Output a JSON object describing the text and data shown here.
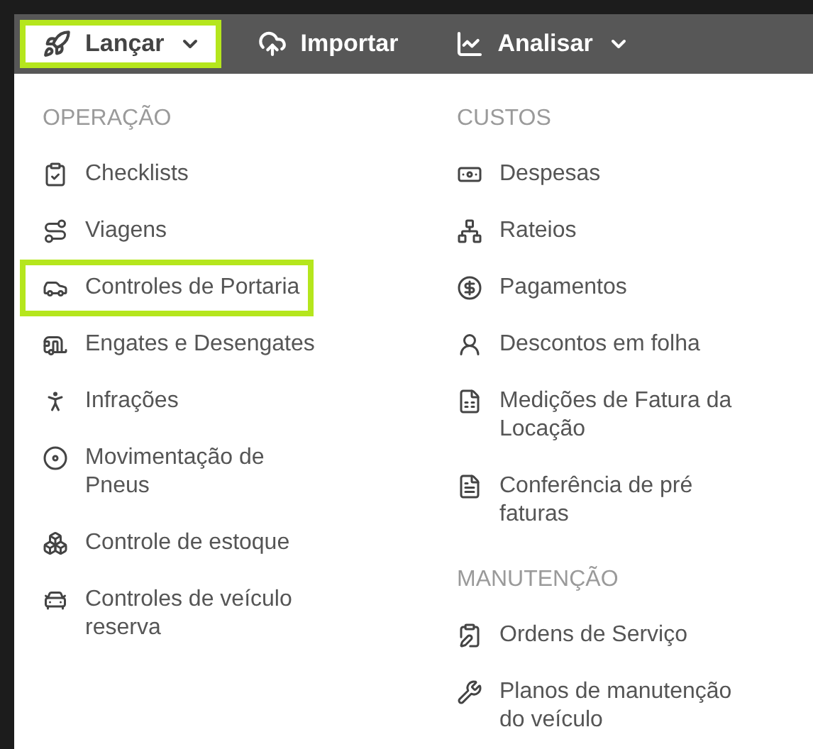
{
  "nav": [
    {
      "label": "Lançar",
      "caret": true,
      "highlighted": true
    },
    {
      "label": "Importar",
      "caret": false,
      "highlighted": false
    },
    {
      "label": "Analisar",
      "caret": true,
      "highlighted": false
    }
  ],
  "columns": [
    {
      "sections": [
        {
          "title": "OPERAÇÃO",
          "items": [
            {
              "label": "Checklists",
              "highlighted": false
            },
            {
              "label": "Viagens",
              "highlighted": false
            },
            {
              "label": "Controles de Portaria",
              "highlighted": true
            },
            {
              "label": "Engates e Desengates",
              "highlighted": false
            },
            {
              "label": "Infrações",
              "highlighted": false
            },
            {
              "label": "Movimentação de Pneus",
              "highlighted": false
            },
            {
              "label": "Controle de estoque",
              "highlighted": false
            },
            {
              "label": "Controles de veículo reserva",
              "highlighted": false
            }
          ]
        }
      ]
    },
    {
      "sections": [
        {
          "title": "CUSTOS",
          "items": [
            {
              "label": "Despesas",
              "highlighted": false
            },
            {
              "label": "Rateios",
              "highlighted": false
            },
            {
              "label": "Pagamentos",
              "highlighted": false
            },
            {
              "label": "Descontos em folha",
              "highlighted": false
            },
            {
              "label": "Medições de Fatura da Locação",
              "highlighted": false
            },
            {
              "label": "Conferência de pré faturas",
              "highlighted": false
            }
          ]
        },
        {
          "title": "MANUTENÇÃO",
          "items": [
            {
              "label": "Ordens de Serviço",
              "highlighted": false
            },
            {
              "label": "Planos de manutenção do veículo",
              "highlighted": false
            }
          ]
        }
      ]
    }
  ]
}
